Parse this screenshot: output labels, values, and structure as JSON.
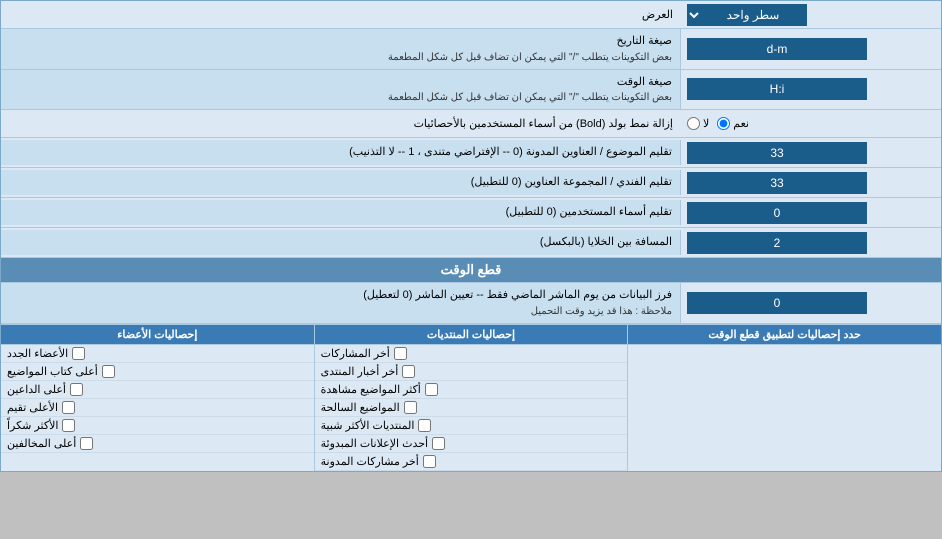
{
  "header": {
    "label": "العرض",
    "single_line_label": "سطر واحد"
  },
  "rows": [
    {
      "id": "date_format",
      "label": "صيغة التاريخ",
      "sublabel": "بعض التكوينات يتطلب \"/\" التي يمكن ان تضاف قبل كل شكل المطعمة",
      "value": "d-m",
      "type": "input"
    },
    {
      "id": "time_format",
      "label": "صيغة الوقت",
      "sublabel": "بعض التكوينات يتطلب \"/\" التي يمكن ان تضاف قبل كل شكل المطعمة",
      "value": "H:i",
      "type": "input"
    },
    {
      "id": "bold_remove",
      "label": "إزالة نمط بولد (Bold) من أسماء المستخدمين بالأحصائيات",
      "type": "radio",
      "options": [
        "نعم",
        "لا"
      ],
      "selected": "نعم"
    },
    {
      "id": "topics_limit",
      "label": "تقليم الموضوع / العناوين المدونة (0 -- الإفتراضي متندى ، 1 -- لا التذنيب)",
      "value": "33",
      "type": "input"
    },
    {
      "id": "forum_limit",
      "label": "تقليم الفندي / المجموعة العناوين (0 للتطبيل)",
      "value": "33",
      "type": "input"
    },
    {
      "id": "usernames_limit",
      "label": "تقليم أسماء المستخدمين (0 للتطبيل)",
      "value": "0",
      "type": "input"
    },
    {
      "id": "cell_distance",
      "label": "المسافة بين الخلايا (بالبكسل)",
      "value": "2",
      "type": "input"
    }
  ],
  "time_cut_section": {
    "title": "قطع الوقت",
    "row": {
      "label": "فرز البيانات من يوم الماشر الماضي فقط -- تعيين الماشر (0 لتعطيل)",
      "note": "ملاحظة : هذا قد يزيد وقت التحميل",
      "value": "0"
    }
  },
  "stats_section": {
    "apply_label": "حدد إحصاليات لتطبيق قطع الوقت",
    "posts_header": "إحصاليات المنتديات",
    "members_header": "إحصاليات الأعضاء",
    "posts_items": [
      "أخر المشاركات",
      "أخر أخبار المنتدى",
      "أكثر المواضيع مشاهدة",
      "المواضيع السالحة",
      "المنتديات الأكثر شبية",
      "أحدث الإعلانات المبدوئة",
      "أخر مشاركات المدونة"
    ],
    "members_items": [
      "الأعضاء الجدد",
      "أعلى كتاب المواضيع",
      "أعلى الداعين",
      "الأعلى تقيم",
      "الأكثر شكراً",
      "أعلى المخالفين"
    ]
  }
}
